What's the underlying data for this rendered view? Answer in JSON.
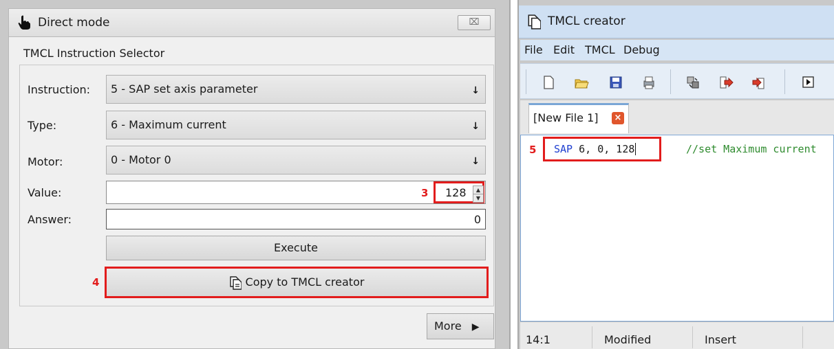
{
  "direct_mode": {
    "title": "Direct mode",
    "close_glyph": "⌧",
    "section_title": "TMCL Instruction Selector",
    "instruction": {
      "label": "Instruction:",
      "value": "5 - SAP set axis parameter"
    },
    "type": {
      "label": "Type:",
      "value": "6 - Maximum current"
    },
    "motor": {
      "label": "Motor:",
      "value": "0 - Motor 0"
    },
    "value_field": {
      "label": "Value:",
      "value": "128"
    },
    "answer": {
      "label": "Answer:",
      "value": "0"
    },
    "execute_label": "Execute",
    "copy_label": "Copy to TMCL creator",
    "more_label": "More",
    "markers": {
      "value": "3",
      "copy": "4"
    },
    "dropdown_arrow": "🡓"
  },
  "tmcl_creator": {
    "title": "TMCL creator",
    "menu": [
      "File",
      "Edit",
      "TMCL",
      "Debug"
    ],
    "toolbar_icons": [
      "new-file-icon",
      "open-folder-icon",
      "save-icon",
      "print-icon",
      "compile-icon",
      "download-icon",
      "upload-icon",
      "run-icon"
    ],
    "tab_label": "[New File 1]",
    "code_line": {
      "line_marker": "5",
      "keyword": "SAP",
      "args": " 6, 0, 128",
      "comment": "//set Maximum current"
    },
    "status": {
      "position": "14:1",
      "state": "Modified",
      "mode": "Insert"
    }
  },
  "colors": {
    "highlight": "#e21c1c",
    "keyword": "#1f3fd0",
    "comment": "#2e8b2e",
    "accent": "#7aa6d6"
  }
}
